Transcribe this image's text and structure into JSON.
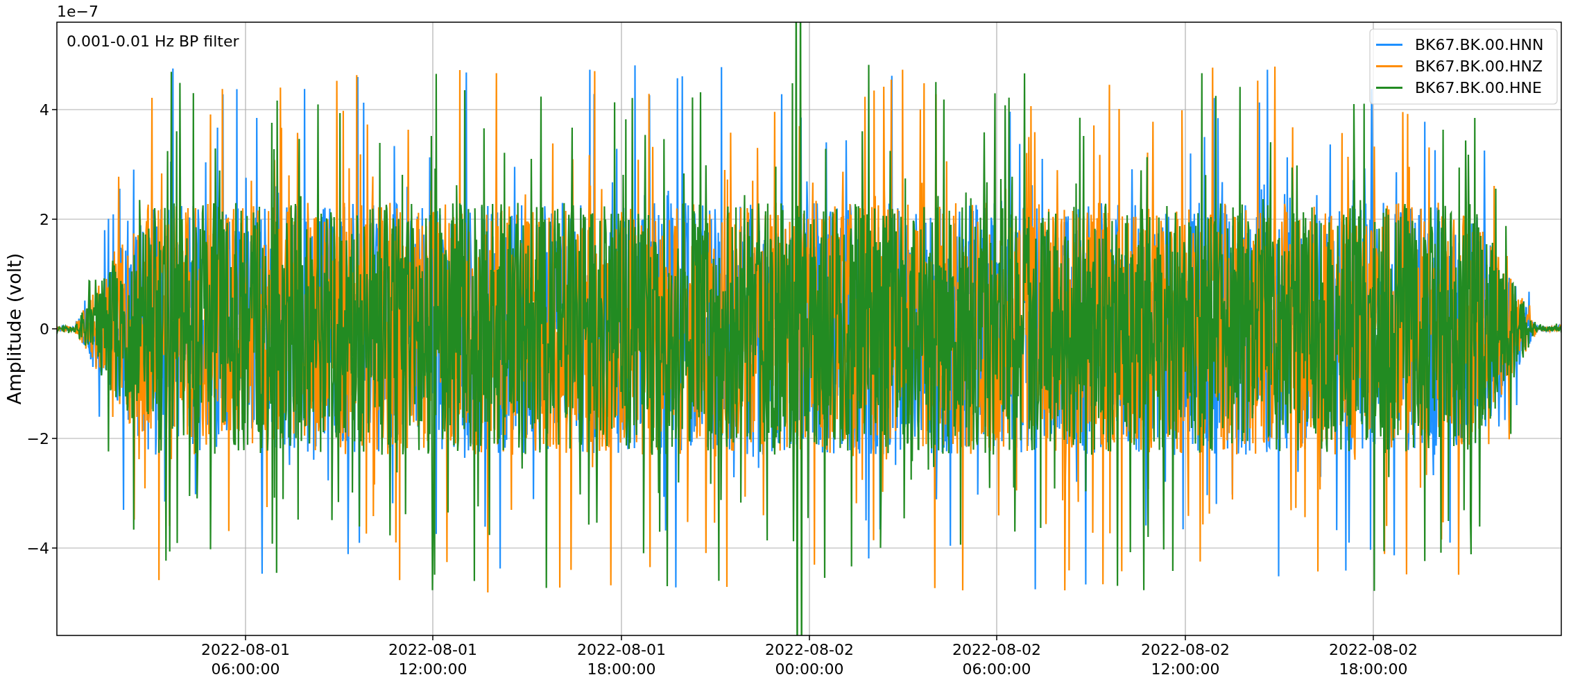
{
  "figure": {
    "exponent_label": "1e−7",
    "ylabel": "Amplitude (volt)",
    "annotation": "0.001-0.01 Hz BP filter",
    "yticks": [
      "4",
      "2",
      "0",
      "−2",
      "−4"
    ],
    "xticks": [
      {
        "date": "2022-08-01",
        "time": "06:00:00"
      },
      {
        "date": "2022-08-01",
        "time": "12:00:00"
      },
      {
        "date": "2022-08-01",
        "time": "18:00:00"
      },
      {
        "date": "2022-08-02",
        "time": "00:00:00"
      },
      {
        "date": "2022-08-02",
        "time": "06:00:00"
      },
      {
        "date": "2022-08-02",
        "time": "12:00:00"
      },
      {
        "date": "2022-08-02",
        "time": "18:00:00"
      }
    ],
    "legend": [
      {
        "label": "BK67.BK.00.HNN",
        "color": "#1e90ff"
      },
      {
        "label": "BK67.BK.00.HNZ",
        "color": "#ff8c00"
      },
      {
        "label": "BK67.BK.00.HNE",
        "color": "#228b22"
      }
    ]
  }
}
